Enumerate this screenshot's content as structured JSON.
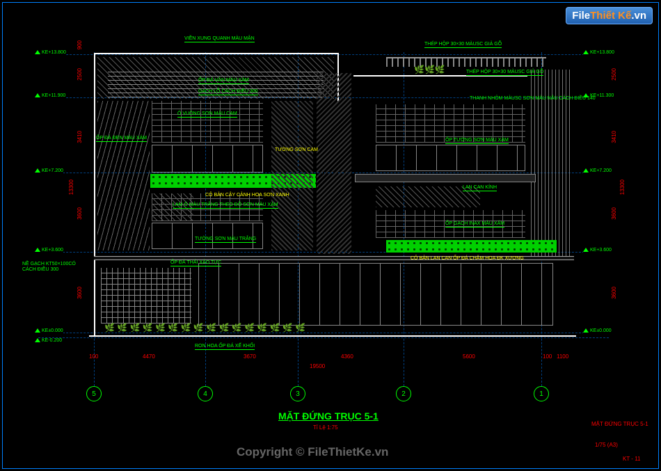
{
  "watermark": {
    "logo_prefix": "File",
    "logo_mid": "Thiết Kế",
    "logo_suffix": ".vn",
    "center": "Copyright © FileThietKe.vn"
  },
  "title": {
    "main": "MẶT ĐỨNG TRỤC 5-1",
    "scale": "Tỉ Lệ 1:75"
  },
  "corner": {
    "name": "MẶT ĐỨNG TRỤC 5-1",
    "scale": "1/75  (A3)",
    "sheet": "KT - 11"
  },
  "levels": [
    {
      "el": "KE+13.800",
      "label": "KE+13.800"
    },
    {
      "el": "KE+11.900",
      "label": "KE+11.900"
    },
    {
      "el": "KE+7.200",
      "label": "KE+7.200"
    },
    {
      "el": "KE+3.600",
      "label": "KE+3.600"
    },
    {
      "el": "KE±0.000",
      "label": "KE±0.000"
    },
    {
      "el": "KE-0.200",
      "label": "KE-0.200"
    }
  ],
  "levels_right": [
    {
      "label": "KE+13.800"
    },
    {
      "label": "KE+11.300"
    },
    {
      "label": "KE+7.200"
    },
    {
      "label": "KE+3.600"
    },
    {
      "label": "KE±0.000"
    }
  ],
  "level_note_left": "NỀ GẠCH KT50×100CÓ\nCÁCH ĐIỀU 300",
  "axes": [
    {
      "n": "5"
    },
    {
      "n": "4"
    },
    {
      "n": "3"
    },
    {
      "n": "2"
    },
    {
      "n": "1"
    }
  ],
  "dims_h": [
    {
      "v": "100"
    },
    {
      "v": "4470"
    },
    {
      "v": "3670"
    },
    {
      "v": "4360"
    },
    {
      "v": "5600"
    },
    {
      "v": "100"
    },
    {
      "v": "1100"
    }
  ],
  "dims_h_total": "19500",
  "dims_v_left": [
    {
      "v": "900"
    },
    {
      "v": "2500"
    },
    {
      "v": "3410"
    },
    {
      "v": "3600"
    },
    {
      "v": "3600"
    }
  ],
  "dims_v_left_total": "13300",
  "dims_v_right": [
    {
      "v": "2500"
    },
    {
      "v": "3410"
    },
    {
      "v": "3600"
    },
    {
      "v": "3600"
    }
  ],
  "dims_v_right_total": "13300",
  "annotations": {
    "top_left": "VIỀN XUNG QUANH MÀU MẬN",
    "op_da_van": "ỐP ĐÁ VÂN MÀU XÁM",
    "gach_lo": "GẠCH LỖ CÁCH ĐIỀU 300",
    "o_vuong": "Ô VUÔNG SƠN MÀU CAM",
    "op_da_den": "ỐP ĐÁ ĐEN MÀU XÁM",
    "tuong_son_cam": "TƯỜNG SƠN CAM",
    "coban_hoa": "CỎ BẢN CÂY CẢNH HOA SƠN XANH",
    "lam_o": "LAM Ô MÀU TRẮNG THEO ĐỒ SƠN MÀU XÁM",
    "tuong_son_trang": "TƯỜNG SƠN MÀU TRẮNG",
    "op_da_tu_nhien": "ỐP ĐÁ THÁI XÁO TỰC",
    "ron_hoa": "RON HOA ỐP ĐÁ XẾ KHỐI",
    "thep_hop_top": "THÉP HỘP 30×30 MÀUSC GIẢ GỖ",
    "thep_hop_sub": "THÉP HỘP 30×30 MÀUSC GIẢ GỖ",
    "thanh_nhom": "THANH NHÔM MÀUSC SƠN MÀU NÂU\nCÁCH ĐIỀU 140",
    "op_tuong_nau": "ỐP TƯỜNG SƠN MÀU XÁM",
    "lan_can_kinh": "LAN CAN KÍNH",
    "op_gach_inax": "ỐP GẠCH INAX MÀU XÁM",
    "coban_lan_can": "CỎ BẢN LAN CAN ỐP ĐÁ CHĂM HOA ĐK XƯƠNG"
  }
}
